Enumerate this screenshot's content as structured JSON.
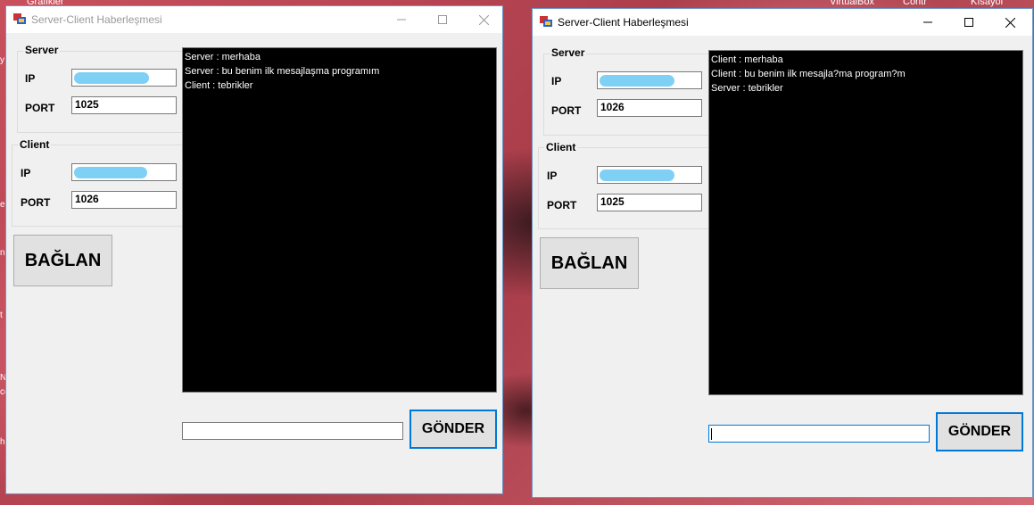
{
  "desktop": {
    "labels": [
      "Grafikler",
      "VirtualBox",
      "Contr",
      "Kısayol"
    ],
    "left_fragments": [
      "y",
      "n",
      "t",
      "N",
      "ce",
      "e",
      "h"
    ]
  },
  "window1": {
    "title": "Server-Client Haberleşmesi",
    "controls": {
      "minimize": "—",
      "maximize": "☐",
      "close": "✕"
    },
    "server_group": {
      "title": "Server",
      "ip_label": "IP",
      "port_label": "PORT",
      "port_value": "1025"
    },
    "client_group": {
      "title": "Client",
      "ip_label": "IP",
      "port_label": "PORT",
      "port_value": "1026"
    },
    "connect_button": "BAĞLAN",
    "log_lines": [
      "Server : merhaba",
      "Server : bu benim ilk mesajlaşma programım",
      "Client : tebrikler"
    ],
    "message_input": "",
    "send_button": "GÖNDER"
  },
  "window2": {
    "title": "Server-Client Haberleşmesi",
    "controls": {
      "minimize": "—",
      "maximize": "☐",
      "close": "✕"
    },
    "server_group": {
      "title": "Server",
      "ip_label": "IP",
      "port_label": "PORT",
      "port_value": "1026"
    },
    "client_group": {
      "title": "Client",
      "ip_label": "IP",
      "port_label": "PORT",
      "port_value": "1025"
    },
    "connect_button": "BAĞLAN",
    "log_lines": [
      "Client : merhaba",
      "Client : bu benim ilk mesajla?ma program?m",
      "Server : tebrikler"
    ],
    "message_input": "",
    "send_button": "GÖNDER"
  },
  "colors": {
    "accent": "#0078d7",
    "log_background": "#000000",
    "redaction": "#7fd0f5"
  }
}
